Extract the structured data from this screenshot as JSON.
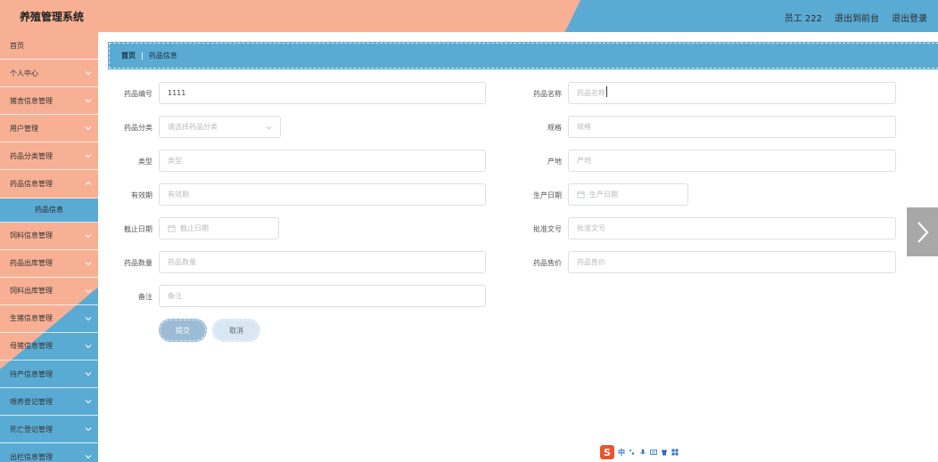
{
  "app": {
    "title": "养殖管理系统"
  },
  "header": {
    "user": "员工 222",
    "back_to_front": "退出到前台",
    "logout": "退出登录"
  },
  "sidebar": {
    "items": [
      {
        "label": "首页",
        "expandable": false
      },
      {
        "label": "个人中心",
        "expandable": true
      },
      {
        "label": "猪舍信息管理",
        "expandable": true
      },
      {
        "label": "用户管理",
        "expandable": true
      },
      {
        "label": "药品分类管理",
        "expandable": true
      },
      {
        "label": "药品信息管理",
        "expandable": true
      }
    ],
    "active_sub": "药品信息",
    "items_after": [
      {
        "label": "饲料信息管理",
        "expandable": true
      },
      {
        "label": "药品出库管理",
        "expandable": true
      },
      {
        "label": "饲料出库管理",
        "expandable": true
      },
      {
        "label": "生猪信息管理",
        "expandable": true
      },
      {
        "label": "母猪信息管理",
        "expandable": true
      },
      {
        "label": "待产信息管理",
        "expandable": true
      },
      {
        "label": "喂养登记管理",
        "expandable": true
      },
      {
        "label": "死亡登记管理",
        "expandable": true
      },
      {
        "label": "出栏信息管理",
        "expandable": true
      }
    ]
  },
  "breadcrumb": {
    "home": "首页",
    "separator": "|",
    "current": "药品信息"
  },
  "form": {
    "drug_code": {
      "label": "药品编号",
      "value": "1111"
    },
    "drug_name": {
      "label": "药品名称",
      "placeholder": "药品名称"
    },
    "category": {
      "label": "药品分类",
      "placeholder": "请选择药品分类"
    },
    "spec": {
      "label": "规格",
      "placeholder": "规格"
    },
    "type": {
      "label": "类型",
      "placeholder": "类型"
    },
    "origin": {
      "label": "产地",
      "placeholder": "产地"
    },
    "validity": {
      "label": "有效期",
      "placeholder": "有效期"
    },
    "production_date": {
      "label": "生产日期",
      "placeholder": "生产日期"
    },
    "expiry_date": {
      "label": "截止日期",
      "placeholder": "截止日期"
    },
    "approval_no": {
      "label": "批准文号",
      "placeholder": "批准文号"
    },
    "quantity": {
      "label": "药品数量",
      "placeholder": "药品数量"
    },
    "price": {
      "label": "药品售价",
      "placeholder": "药品售价"
    },
    "remark": {
      "label": "备注",
      "placeholder": "备注"
    }
  },
  "buttons": {
    "submit": "提交",
    "cancel": "取消"
  },
  "ime": {
    "logo": "S",
    "lang": "中"
  },
  "colors": {
    "peach": "#f7b094",
    "blue": "#5aabd3",
    "submit": "#9cbcd6",
    "cancel": "#d8e7f1",
    "arrow_tab": "#a8a8a8"
  }
}
